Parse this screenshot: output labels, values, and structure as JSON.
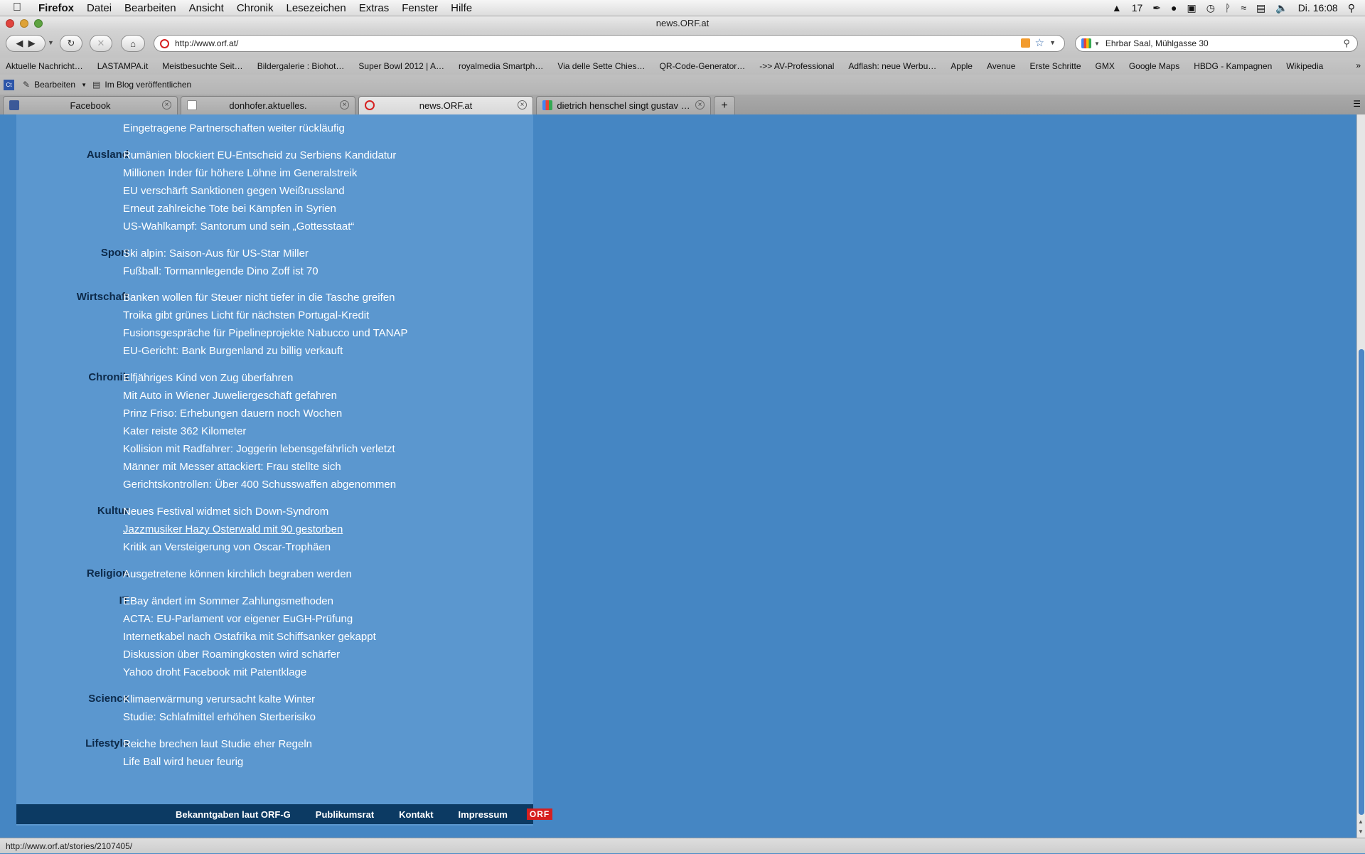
{
  "menubar": {
    "app": "Firefox",
    "items": [
      "Datei",
      "Bearbeiten",
      "Ansicht",
      "Chronik",
      "Lesezeichen",
      "Extras",
      "Fenster",
      "Hilfe"
    ],
    "status_count": "17",
    "clock": "Di. 16:08"
  },
  "window": {
    "title": "news.ORF.at"
  },
  "toolbar": {
    "url": "http://www.orf.at/",
    "search": "Ehrbar Saal, Mühlgasse 30"
  },
  "bookmarks": [
    "Aktuelle Nachricht…",
    "LASTAMPA.it",
    "Meistbesuchte Seit…",
    "Bildergalerie : Biohot…",
    "Super Bowl 2012 | A…",
    "royalmedia Smartph…",
    "Via delle Sette Chies…",
    "QR-Code-Generator…",
    "->> AV-Professional",
    "Adflash: neue Werbu…",
    "Apple",
    "Avenue",
    "Erste Schritte",
    "GMX",
    "Google Maps",
    "HBDG - Kampagnen",
    "Wikipedia"
  ],
  "extrabar": {
    "edit": "Bearbeiten",
    "blog": "Im Blog veröffentlichen"
  },
  "tabs": [
    {
      "label": "Facebook"
    },
    {
      "label": "donhofer.aktuelles."
    },
    {
      "label": "news.ORF.at"
    },
    {
      "label": "dietrich henschel singt gustav …"
    }
  ],
  "news": {
    "top_item": "Eingetragene Partnerschaften weiter rückläufig",
    "sections": [
      {
        "cat": "Ausland",
        "items": [
          "Rumänien blockiert EU-Entscheid zu Serbiens Kandidatur",
          "Millionen Inder für höhere Löhne im Generalstreik",
          "EU verschärft Sanktionen gegen Weißrussland",
          "Erneut zahlreiche Tote bei Kämpfen in Syrien",
          "US-Wahlkampf: Santorum und sein „Gottesstaat“"
        ]
      },
      {
        "cat": "Sport",
        "items": [
          "Ski alpin: Saison-Aus für US-Star Miller",
          "Fußball: Tormannlegende Dino Zoff ist 70"
        ]
      },
      {
        "cat": "Wirtschaft",
        "items": [
          "Banken wollen für Steuer nicht tiefer in die Tasche greifen",
          "Troika gibt grünes Licht für nächsten Portugal-Kredit",
          "Fusionsgespräche für Pipelineprojekte Nabucco und TANAP",
          "EU-Gericht: Bank Burgenland zu billig verkauft"
        ]
      },
      {
        "cat": "Chronik",
        "items": [
          "Elfjähriges Kind von Zug überfahren",
          "Mit Auto in Wiener Juweliergeschäft gefahren",
          "Prinz Friso: Erhebungen dauern noch Wochen",
          "Kater reiste 362 Kilometer",
          "Kollision mit Radfahrer: Joggerin lebensgefährlich verletzt",
          "Männer mit Messer attackiert: Frau stellte sich",
          "Gerichtskontrollen: Über 400 Schusswaffen abgenommen"
        ]
      },
      {
        "cat": "Kultur",
        "items": [
          "Neues Festival widmet sich Down-Syndrom",
          "Jazzmusiker Hazy Osterwald mit 90 gestorben",
          "Kritik an Versteigerung von Oscar-Trophäen"
        ]
      },
      {
        "cat": "Religion",
        "items": [
          "Ausgetretene können kirchlich begraben werden"
        ]
      },
      {
        "cat": "IT",
        "items": [
          "EBay ändert im Sommer Zahlungsmethoden",
          "ACTA: EU-Parlament vor eigener EuGH-Prüfung",
          "Internetkabel nach Ostafrika mit Schiffsanker gekappt",
          "Diskussion über Roamingkosten wird schärfer",
          "Yahoo droht Facebook mit Patentklage"
        ]
      },
      {
        "cat": "Science",
        "items": [
          "Klimaerwärmung verursacht kalte Winter",
          "Studie: Schlafmittel erhöhen Sterberisiko"
        ]
      },
      {
        "cat": "Lifestyle",
        "items": [
          "Reiche brechen laut Studie eher Regeln",
          "Life Ball wird heuer feurig"
        ]
      }
    ]
  },
  "footer": {
    "links": [
      "Bekanntgaben laut ORF-G",
      "Publikumsrat",
      "Kontakt",
      "Impressum"
    ],
    "logo": "ORF"
  },
  "status": "http://www.orf.at/stories/2107405/"
}
